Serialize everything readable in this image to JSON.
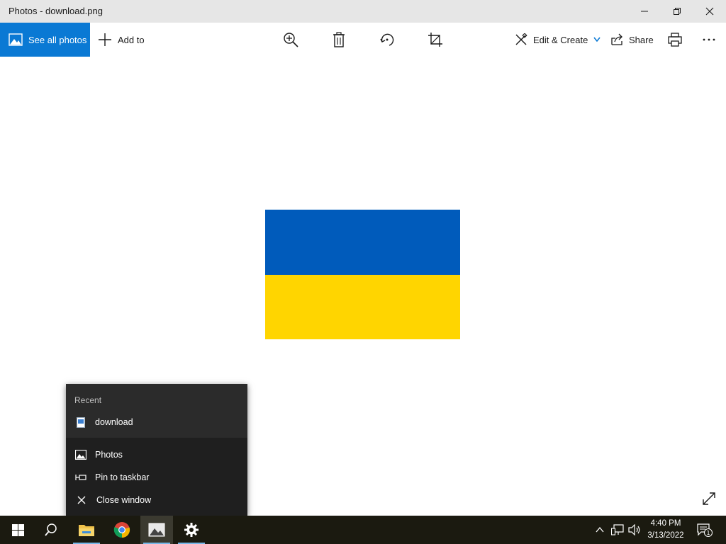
{
  "window": {
    "title": "Photos - download.png"
  },
  "toolbar": {
    "see_all_label": "See all photos",
    "add_to_label": "Add to",
    "edit_create_label": "Edit & Create",
    "share_label": "Share"
  },
  "image": {
    "colors": {
      "top": "#005bbb",
      "bottom": "#ffd500"
    }
  },
  "jumplist": {
    "recent_header": "Recent",
    "recent_items": [
      "download"
    ],
    "app_label": "Photos",
    "pin_label": "Pin to taskbar",
    "close_label": "Close window"
  },
  "taskbar": {
    "apps": [
      "start-icon",
      "search-icon",
      "file-explorer-icon",
      "chrome-icon",
      "photos-icon",
      "settings-icon"
    ],
    "time": "4:40 PM",
    "date": "3/13/2022",
    "notification_count": "1"
  },
  "colors": {
    "accent": "#0a79d4",
    "titlebar": "#e6e6e6",
    "taskbar": "#1b1a10",
    "jumplist": "#1f1f1f"
  }
}
